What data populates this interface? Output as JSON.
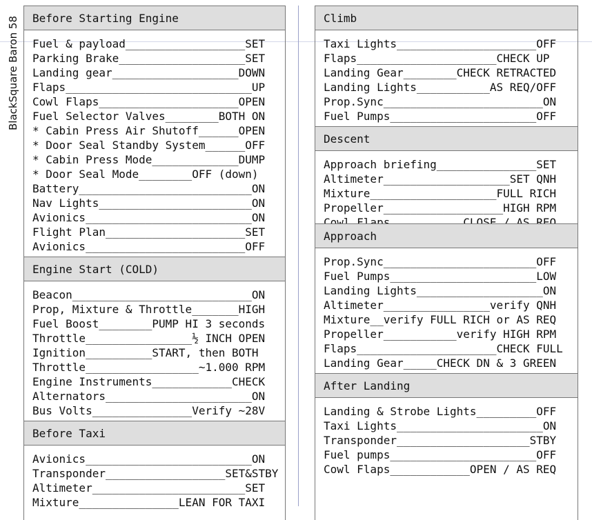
{
  "side_title": "BlackSquare Baron 58",
  "left": [
    {
      "heading": "Before Starting Engine",
      "items": [
        "Fuel & payload__________________SET",
        "Parking Brake___________________SET",
        "Landing gear___________________DOWN",
        "Flaps____________________________UP",
        "Cowl Flaps_____________________OPEN",
        "Fuel Selector Valves________BOTH ON",
        "* Cabin Press Air Shutoff______OPEN",
        "* Door Seal Standby System______OFF",
        "* Cabin Press Mode_____________DUMP",
        "* Door Seal Mode________OFF (down)",
        "Battery__________________________ON",
        "Nav Lights_______________________ON",
        "Avionics_________________________ON",
        "Flight Plan_____________________SET",
        "Avionics________________________OFF"
      ]
    },
    {
      "heading": "Engine Start (COLD)",
      "items": [
        "Beacon___________________________ON",
        "Prop, Mixture & Throttle_______HIGH",
        "Fuel Boost________PUMP HI 3 seconds",
        "Throttle________________½ INCH OPEN",
        "Ignition__________START, then BOTH",
        "Throttle_________________~1.000 RPM",
        "Engine Instruments____________CHECK",
        "Alternators______________________ON",
        "Bus Volts_______________Verify ~28V"
      ]
    },
    {
      "heading": "Before Taxi",
      "items": [
        "Avionics_________________________ON",
        "Transponder__________________SET&STBY",
        "Altimeter_______________________SET",
        "Mixture_______________LEAN FOR TAXI"
      ]
    }
  ],
  "right": [
    {
      "heading": "Climb",
      "items": [
        "Taxi Lights_____________________OFF",
        "Flaps_____________________CHECK UP",
        "Landing Gear________CHECK RETRACTED",
        "Landing Lights___________AS REQ/OFF",
        "Prop.Sync________________________ON",
        "Fuel Pumps______________________OFF"
      ]
    },
    {
      "heading": "Descent",
      "items": [
        "Approach briefing_______________SET",
        "Altimeter___________________SET QNH",
        "Mixture___________________FULL RICH",
        "Propeller__________________HIGH RPM",
        "Cowl Flaps___________CLOSE / AS REQ"
      ]
    },
    {
      "heading": "Approach",
      "items": [
        "Prop.Sync_______________________OFF",
        "Fuel Pumps______________________LOW",
        "Landing Lights___________________ON",
        "Altimeter________________verify QNH",
        "Mixture__verify FULL RICH or AS REQ",
        "Propeller___________verify HIGH RPM",
        "Flaps_____________________CHECK FULL",
        "Landing Gear_____CHECK DN & 3 GREEN"
      ]
    },
    {
      "heading": "After Landing",
      "items": [
        "Landing & Strobe Lights_________OFF",
        "Taxi Lights______________________ON",
        "Transponder____________________STBY",
        "Fuel pumps______________________OFF",
        "Cowl Flaps____________OPEN / AS REQ"
      ]
    }
  ]
}
